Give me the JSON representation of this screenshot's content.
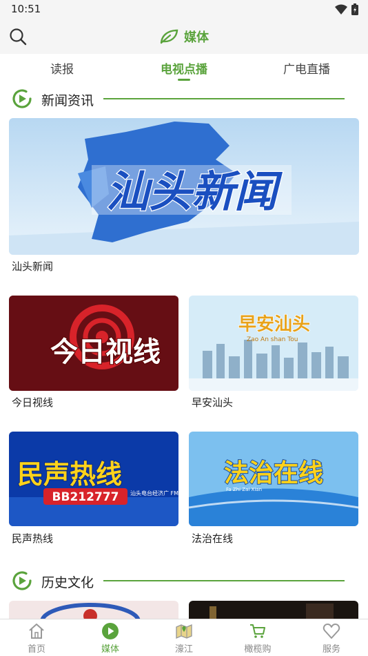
{
  "status_bar": {
    "time": "10:51"
  },
  "header": {
    "title": "媒体"
  },
  "tabs": [
    {
      "label": "读报"
    },
    {
      "label": "电视点播",
      "active": true
    },
    {
      "label": "广电直播"
    }
  ],
  "sections": [
    {
      "title": "新闻资讯",
      "programs": [
        {
          "label": "汕头新闻",
          "banner_text": "汕头新闻"
        },
        {
          "label": "今日视线",
          "banner_text": "今日视线"
        },
        {
          "label": "早安汕头",
          "banner_text": "早安汕头",
          "banner_subtext": "Zao An shan Tou"
        },
        {
          "label": "民声热线",
          "banner_text": "民声热线",
          "banner_subtext": "BB212777",
          "banner_caption": "汕头电台经济广 FM102.0"
        },
        {
          "label": "法治在线",
          "banner_text": "法治在线",
          "banner_subtext": "Fa Zhi Zai Xian"
        }
      ]
    },
    {
      "title": "历史文化"
    }
  ],
  "bottom_nav": [
    {
      "label": "首页",
      "icon": "home-icon"
    },
    {
      "label": "媒体",
      "icon": "play-circle-icon",
      "active": true
    },
    {
      "label": "濠江",
      "icon": "map-icon"
    },
    {
      "label": "橄榄购",
      "icon": "cart-icon"
    },
    {
      "label": "服务",
      "icon": "heart-icon"
    }
  ],
  "colors": {
    "accent": "#5aa33c",
    "header_bg": "#f5f5f5",
    "text": "#222222",
    "nav_inactive": "#888888"
  }
}
